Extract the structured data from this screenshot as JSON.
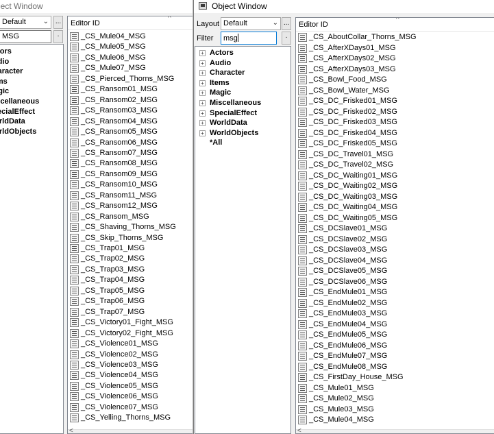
{
  "left_window": {
    "title": "Object Window",
    "layout_value": "Default",
    "filter_value": "MSG",
    "categories": [
      "Actors",
      "Audio",
      "Character",
      "Items",
      "Magic",
      "Miscellaneous",
      "SpecialEffect",
      "WorldData",
      "WorldObjects"
    ],
    "column_header": "Editor ID",
    "rows": [
      "_CS_Mule04_MSG",
      "_CS_Mule05_MSG",
      "_CS_Mule06_MSG",
      "_CS_Mule07_MSG",
      "_CS_Pierced_Thorns_MSG",
      "_CS_Ransom01_MSG",
      "_CS_Ransom02_MSG",
      "_CS_Ransom03_MSG",
      "_CS_Ransom04_MSG",
      "_CS_Ransom05_MSG",
      "_CS_Ransom06_MSG",
      "_CS_Ransom07_MSG",
      "_CS_Ransom08_MSG",
      "_CS_Ransom09_MSG",
      "_CS_Ransom10_MSG",
      "_CS_Ransom11_MSG",
      "_CS_Ransom12_MSG",
      "_CS_Ransom_MSG",
      "_CS_Shaving_Thorns_MSG",
      "_CS_Skip_Thorns_MSG",
      "_CS_Trap01_MSG",
      "_CS_Trap02_MSG",
      "_CS_Trap03_MSG",
      "_CS_Trap04_MSG",
      "_CS_Trap05_MSG",
      "_CS_Trap06_MSG",
      "_CS_Trap07_MSG",
      "_CS_Victory01_Fight_MSG",
      "_CS_Victory02_Fight_MSG",
      "_CS_Violence01_MSG",
      "_CS_Violence02_MSG",
      "_CS_Violence03_MSG",
      "_CS_Violence04_MSG",
      "_CS_Violence05_MSG",
      "_CS_Violence06_MSG",
      "_CS_Violence07_MSG",
      "_CS_Yelling_Thorns_MSG"
    ]
  },
  "right_window": {
    "title": "Object Window",
    "layout_label": "Layout",
    "layout_value": "Default",
    "filter_label": "Filter",
    "filter_value": "msg",
    "categories": [
      "Actors",
      "Audio",
      "Character",
      "Items",
      "Magic",
      "Miscellaneous",
      "SpecialEffect",
      "WorldData",
      "WorldObjects",
      "*All"
    ],
    "column_header": "Editor ID",
    "rows": [
      "_CS_AboutCollar_Thorns_MSG",
      "_CS_AfterXDays01_MSG",
      "_CS_AfterXDays02_MSG",
      "_CS_AfterXDays03_MSG",
      "_CS_Bowl_Food_MSG",
      "_CS_Bowl_Water_MSG",
      "_CS_DC_Frisked01_MSG",
      "_CS_DC_Frisked02_MSG",
      "_CS_DC_Frisked03_MSG",
      "_CS_DC_Frisked04_MSG",
      "_CS_DC_Frisked05_MSG",
      "_CS_DC_Travel01_MSG",
      "_CS_DC_Travel02_MSG",
      "_CS_DC_Waiting01_MSG",
      "_CS_DC_Waiting02_MSG",
      "_CS_DC_Waiting03_MSG",
      "_CS_DC_Waiting04_MSG",
      "_CS_DC_Waiting05_MSG",
      "_CS_DCSlave01_MSG",
      "_CS_DCSlave02_MSG",
      "_CS_DCSlave03_MSG",
      "_CS_DCSlave04_MSG",
      "_CS_DCSlave05_MSG",
      "_CS_DCSlave06_MSG",
      "_CS_EndMule01_MSG",
      "_CS_EndMule02_MSG",
      "_CS_EndMule03_MSG",
      "_CS_EndMule04_MSG",
      "_CS_EndMule05_MSG",
      "_CS_EndMule06_MSG",
      "_CS_EndMule07_MSG",
      "_CS_EndMule08_MSG",
      "_CS_FirstDay_House_MSG",
      "_CS_Mule01_MSG",
      "_CS_Mule02_MSG",
      "_CS_Mule03_MSG",
      "_CS_Mule04_MSG"
    ]
  },
  "icons": {
    "expander": "plus-box-icon",
    "row_icon": "message-form-icon",
    "sort": "sort-ascending-icon"
  },
  "colors": {
    "window_bg": "#f0f0f0",
    "pane_bg": "#ffffff",
    "focus_border": "#0078d7"
  }
}
